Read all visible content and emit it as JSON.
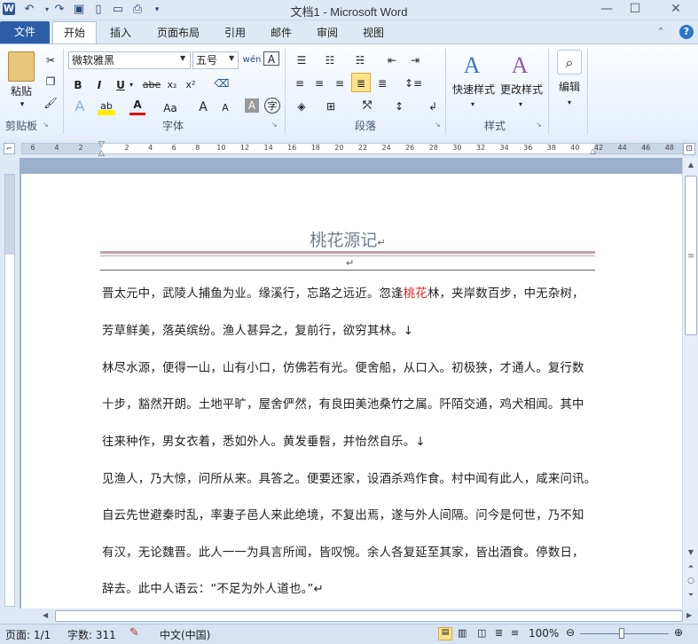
{
  "window": {
    "title": "文档1 - Microsoft Word",
    "app_icon": "W"
  },
  "qat": [
    "undo-icon",
    "redo-icon",
    "save-icon",
    "new-icon",
    "open-icon",
    "print-icon",
    "customize-icon"
  ],
  "tabs": {
    "file": "文件",
    "items": [
      "开始",
      "插入",
      "页面布局",
      "引用",
      "邮件",
      "审阅",
      "视图"
    ]
  },
  "ribbon": {
    "clipboard": {
      "paste": "粘贴",
      "label": "剪贴板"
    },
    "font": {
      "name": "微软雅黑",
      "size": "五号",
      "label": "字体",
      "bold": "B",
      "italic": "I",
      "underline": "U",
      "strike": "abe",
      "sub": "x₂",
      "sup": "x²",
      "grow": "A",
      "shrink": "A",
      "case": "Aa",
      "char_border": "A",
      "phonetic": "wén",
      "char_shade": "A",
      "enclose": "字"
    },
    "paragraph": {
      "label": "段落"
    },
    "styles": {
      "quick": "快速样式",
      "change": "更改样式",
      "label": "样式"
    },
    "editing": {
      "label": "编辑"
    }
  },
  "ruler": {
    "left_numbers": [
      "6",
      "4",
      "2",
      "2"
    ],
    "right_numbers": [
      "2",
      "4",
      "6",
      "8",
      "10",
      "12",
      "14",
      "16",
      "18",
      "20",
      "22",
      "24",
      "26",
      "28",
      "30",
      "32",
      "34",
      "36",
      "38",
      "40",
      "42",
      "44",
      "46",
      "48"
    ]
  },
  "document": {
    "title": "桃花源记",
    "paragraph_mark": "↵",
    "lines": [
      {
        "pre": "晋太元中，武陵人捕鱼为业。缘溪行，忘路之远近。忽逢",
        "red": "桃花",
        "post": "林，夹岸数百步，中无杂树，"
      },
      {
        "pre": "芳草鲜美，落英缤纷。渔人甚异之，复前行，欲穷其林。↓",
        "red": "",
        "post": ""
      },
      {
        "pre": "林尽水源，便得一山，山有小口，仿佛若有光。便舍船，从口入。初极狭，才通人。复行数",
        "red": "",
        "post": ""
      },
      {
        "pre": "十步，豁然开朗。土地平旷，屋舍俨然，有良田美池桑竹之属。阡陌交通，鸡犬相闻。其中",
        "red": "",
        "post": ""
      },
      {
        "pre": "往来种作，男女衣着，悉如外人。黄发垂髫，并怡然自乐。↓",
        "red": "",
        "post": ""
      },
      {
        "pre": "见渔人，乃大惊，问所从来。具答之。便要还家，设酒杀鸡作食。村中闻有此人，咸来问讯。",
        "red": "",
        "post": ""
      },
      {
        "pre": "自云先世避秦时乱，率妻子邑人来此绝境，不复出焉，遂与外人间隔。问今是何世，乃不知",
        "red": "",
        "post": ""
      },
      {
        "pre": "有汉，无论魏晋。此人一一为具言所闻，皆叹惋。余人各复延至其家，皆出酒食。停数日，",
        "red": "",
        "post": ""
      },
      {
        "pre": "辞去。此中人语云：“不足为外人道也。”↵",
        "red": "",
        "post": ""
      }
    ]
  },
  "status": {
    "page": "页面: 1/1",
    "words": "字数: 311",
    "lang": "中文(中国)",
    "zoom": "100%"
  },
  "colors": {
    "file_tab": "#2c5ea8",
    "accent_red": "#e02020",
    "title_rule": "#c4a0a6"
  }
}
